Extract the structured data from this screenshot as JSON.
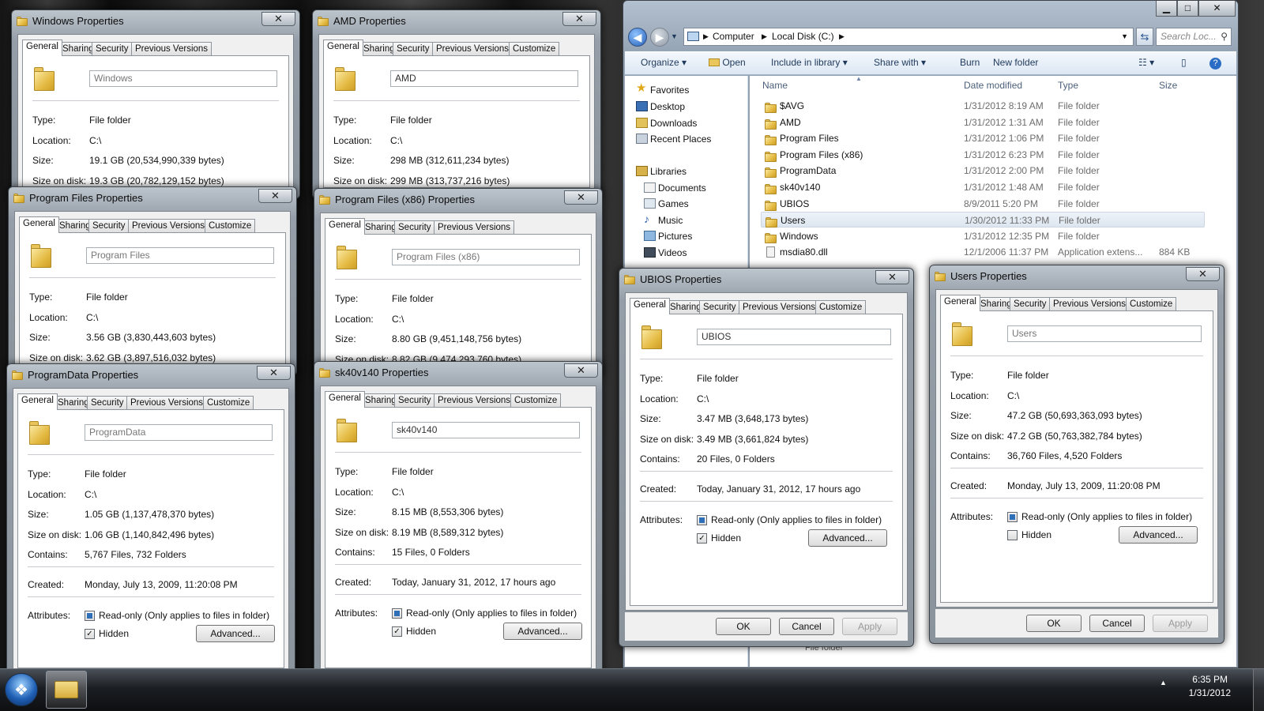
{
  "props_tabs": [
    "General",
    "Sharing",
    "Security",
    "Previous Versions",
    "Customize"
  ],
  "labels": {
    "type": "Type:",
    "location": "Location:",
    "size": "Size:",
    "size_on_disk": "Size on disk:",
    "contains": "Contains:",
    "created": "Created:",
    "attributes": "Attributes:",
    "readonly": "Read-only (Only applies to files in folder)",
    "hidden": "Hidden",
    "advanced": "Advanced...",
    "ok": "OK",
    "cancel": "Cancel",
    "apply": "Apply",
    "close": "✕"
  },
  "dialogs": {
    "windows": {
      "title": "Windows Properties",
      "name": "Windows",
      "type": "File folder",
      "location": "C:\\",
      "size": "19.1 GB (20,534,990,339 bytes)",
      "size_on_disk": "19.3 GB (20,782,129,152 bytes)"
    },
    "amd": {
      "title": "AMD Properties",
      "name": "AMD",
      "type": "File folder",
      "location": "C:\\",
      "size": "298 MB (312,611,234 bytes)",
      "size_on_disk": "299 MB (313,737,216 bytes)"
    },
    "program_files": {
      "title": "Program Files Properties",
      "name": "Program Files",
      "type": "File folder",
      "location": "C:\\",
      "size": "3.56 GB (3,830,443,603 bytes)",
      "size_on_disk": "3.62 GB (3,897,516,032 bytes)"
    },
    "program_files_x86": {
      "title": "Program Files (x86) Properties",
      "name": "Program Files (x86)",
      "type": "File folder",
      "location": "C:\\",
      "size": "8.80 GB (9,451,148,756 bytes)",
      "size_on_disk": "8.82 GB (9,474,293,760 bytes)"
    },
    "programdata": {
      "title": "ProgramData Properties",
      "name": "ProgramData",
      "type": "File folder",
      "location": "C:\\",
      "size": "1.05 GB (1,137,478,370 bytes)",
      "size_on_disk": "1.06 GB (1,140,842,496 bytes)",
      "contains": "5,767 Files, 732 Folders",
      "created": "Monday, July 13, 2009, 11:20:08 PM",
      "readonly": true,
      "hidden": true
    },
    "sk40v140": {
      "title": "sk40v140 Properties",
      "name": "sk40v140",
      "type": "File folder",
      "location": "C:\\",
      "size": "8.15 MB (8,553,306 bytes)",
      "size_on_disk": "8.19 MB (8,589,312 bytes)",
      "contains": "15 Files, 0 Folders",
      "created": "Today, January 31, 2012, 17 hours ago",
      "readonly": true,
      "hidden": true
    },
    "ubios": {
      "title": "UBIOS Properties",
      "name": "UBIOS",
      "type": "File folder",
      "location": "C:\\",
      "size": "3.47 MB (3,648,173 bytes)",
      "size_on_disk": "3.49 MB (3,661,824 bytes)",
      "contains": "20 Files, 0 Folders",
      "created": "Today, January 31, 2012, 17 hours ago",
      "readonly": true,
      "hidden": true
    },
    "users": {
      "title": "Users Properties",
      "name": "Users",
      "type": "File folder",
      "location": "C:\\",
      "size": "47.2 GB (50,693,363,093 bytes)",
      "size_on_disk": "47.2 GB (50,763,382,784 bytes)",
      "contains": "36,760 Files, 4,520 Folders",
      "created": "Monday, July 13, 2009, 11:20:08 PM",
      "readonly": true,
      "hidden": false
    }
  },
  "explorer": {
    "breadcrumb": [
      "Computer",
      "Local Disk (C:)"
    ],
    "search_placeholder": "Search Loc...",
    "toolbar": {
      "organize": "Organize",
      "open": "Open",
      "include": "Include in library",
      "share": "Share with",
      "burn": "Burn",
      "new_folder": "New folder"
    },
    "nav": {
      "favorites": "Favorites",
      "desktop": "Desktop",
      "downloads": "Downloads",
      "recent": "Recent Places",
      "libraries": "Libraries",
      "documents": "Documents",
      "games": "Games",
      "music": "Music",
      "pictures": "Pictures",
      "videos": "Videos"
    },
    "columns": {
      "name": "Name",
      "date": "Date modified",
      "type": "Type",
      "size": "Size"
    },
    "files": [
      {
        "name": "$AVG",
        "date": "1/31/2012 8:19 AM",
        "type": "File folder",
        "size": ""
      },
      {
        "name": "AMD",
        "date": "1/31/2012 1:31 AM",
        "type": "File folder",
        "size": ""
      },
      {
        "name": "Program Files",
        "date": "1/31/2012 1:06 PM",
        "type": "File folder",
        "size": ""
      },
      {
        "name": "Program Files (x86)",
        "date": "1/31/2012 6:23 PM",
        "type": "File folder",
        "size": ""
      },
      {
        "name": "ProgramData",
        "date": "1/31/2012 2:00 PM",
        "type": "File folder",
        "size": ""
      },
      {
        "name": "sk40v140",
        "date": "1/31/2012 1:48 AM",
        "type": "File folder",
        "size": ""
      },
      {
        "name": "UBIOS",
        "date": "8/9/2011 5:20 PM",
        "type": "File folder",
        "size": ""
      },
      {
        "name": "Users",
        "date": "1/30/2012 11:33 PM",
        "type": "File folder",
        "size": "",
        "selected": true
      },
      {
        "name": "Windows",
        "date": "1/31/2012 12:35 PM",
        "type": "File folder",
        "size": ""
      },
      {
        "name": "msdia80.dll",
        "date": "12/1/2006 11:37 PM",
        "type": "Application extens...",
        "size": "884 KB"
      }
    ],
    "status_peek": "File folder"
  },
  "taskbar": {
    "time": "6:35 PM",
    "date": "1/31/2012"
  }
}
